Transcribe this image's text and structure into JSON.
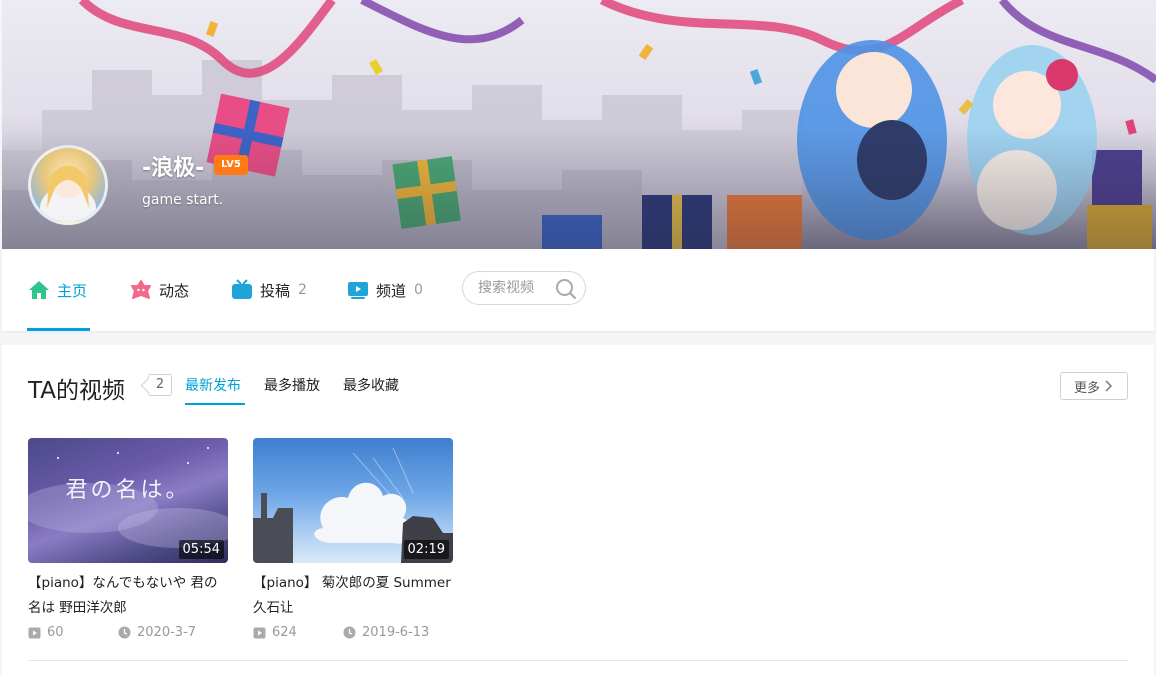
{
  "profile": {
    "username": "-浪极-",
    "level": "LV5",
    "bio": "game start."
  },
  "nav": {
    "items": [
      {
        "label": "主页",
        "count": "",
        "icon": "home-icon"
      },
      {
        "label": "动态",
        "count": "",
        "icon": "dynamic-icon"
      },
      {
        "label": "投稿",
        "count": "2",
        "icon": "tv-icon"
      },
      {
        "label": "频道",
        "count": "0",
        "icon": "channel-icon"
      }
    ],
    "search_placeholder": "搜索视频"
  },
  "videos_section": {
    "title": "TA的视频",
    "count": "2",
    "tabs": [
      "最新发布",
      "最多播放",
      "最多收藏"
    ],
    "more_label": "更多",
    "items": [
      {
        "title": "【piano】なんでもないや 君の名は 野田洋次郎",
        "duration": "05:54",
        "plays": "60",
        "date": "2020-3-7",
        "thumb_text": "君の名は。"
      },
      {
        "title": "【piano】 菊次郎の夏 Summer 久石让",
        "duration": "02:19",
        "plays": "624",
        "date": "2019-6-13"
      }
    ]
  },
  "colors": {
    "accent": "#00a1d6",
    "level_badge": "#ff7a14",
    "home_icon": "#2fc48d",
    "dynamic_icon": "#f06a8a",
    "tv_icon": "#1fa3d8"
  }
}
